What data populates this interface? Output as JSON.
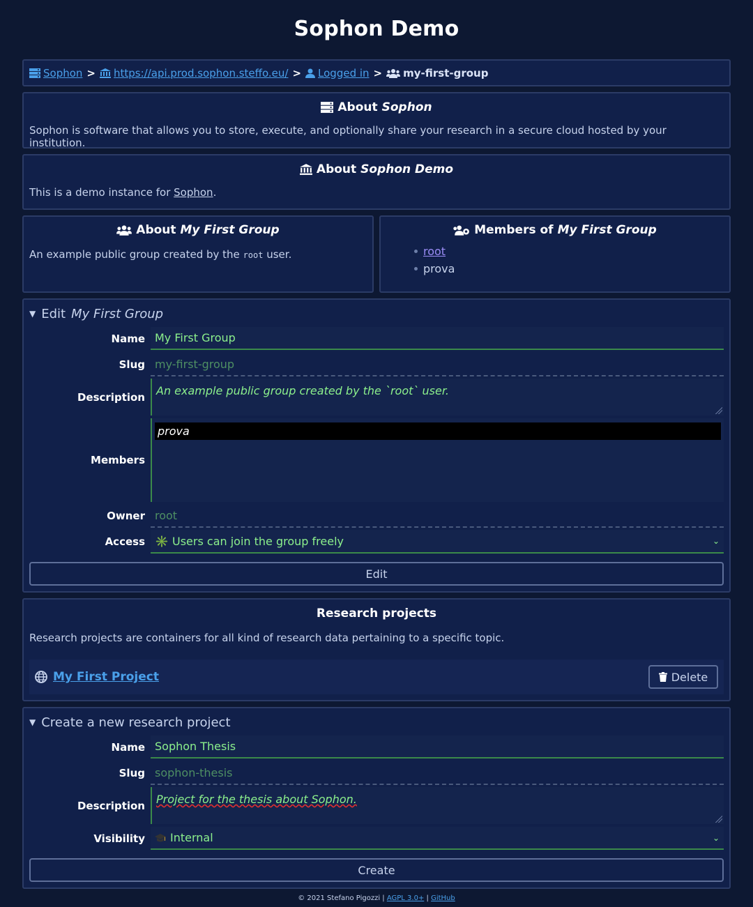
{
  "page": {
    "title": "Sophon Demo"
  },
  "breadcrumb": {
    "items": [
      {
        "label": "Sophon",
        "icon": "server-icon"
      },
      {
        "label": "https://api.prod.sophon.steffo.eu/",
        "icon": "university-icon"
      },
      {
        "label": "Logged in",
        "icon": "user-icon"
      },
      {
        "label": "my-first-group",
        "icon": "users-icon"
      }
    ]
  },
  "about_sophon": {
    "title_prefix": "About",
    "title_name": "Sophon",
    "text": "Sophon is software that allows you to store, execute, and optionally share your research in a secure cloud hosted by your institution."
  },
  "about_instance": {
    "title_prefix": "About",
    "title_name": "Sophon Demo",
    "text_before": "This is a demo instance for ",
    "text_link": "Sophon",
    "text_after": "."
  },
  "about_group": {
    "title_prefix": "About",
    "title_name": "My First Group",
    "text_before": "An example public group created by the ",
    "text_code": "root",
    "text_after": " user."
  },
  "members_panel": {
    "title_prefix": "Members of",
    "title_name": "My First Group",
    "members": [
      "root",
      "prova"
    ]
  },
  "edit_group": {
    "summary_prefix": "Edit",
    "summary_name": "My First Group",
    "name_label": "Name",
    "name_value": "My First Group",
    "slug_label": "Slug",
    "slug_value": "my-first-group",
    "description_label": "Description",
    "description_value": "An example public group created by the `root` user.",
    "members_label": "Members",
    "members_selected": [
      "prova"
    ],
    "owner_label": "Owner",
    "owner_value": "root",
    "access_label": "Access",
    "access_value": "✳️ Users can join the group freely",
    "submit_label": "Edit"
  },
  "projects": {
    "title": "Research projects",
    "text": "Research projects are containers for all kind of research data pertaining to a specific topic.",
    "items": [
      {
        "name": "My First Project",
        "icon": "globe-icon",
        "delete_label": "Delete"
      }
    ]
  },
  "create_project": {
    "summary": "Create a new research project",
    "name_label": "Name",
    "name_value": "Sophon Thesis",
    "slug_label": "Slug",
    "slug_value": "sophon-thesis",
    "description_label": "Description",
    "description_value": "Project for the thesis about Sophon.",
    "visibility_label": "Visibility",
    "visibility_value": "Internal",
    "submit_label": "Create"
  },
  "footer": {
    "copyright": "© 2021 Stefano Pigozzi",
    "sep": "|",
    "license": "AGPL 3.0+",
    "github": "GitHub"
  },
  "colors": {
    "background": "#0d1832",
    "panel": "#11204a",
    "link": "#4aa0ea",
    "field_text": "#8cf08c"
  }
}
